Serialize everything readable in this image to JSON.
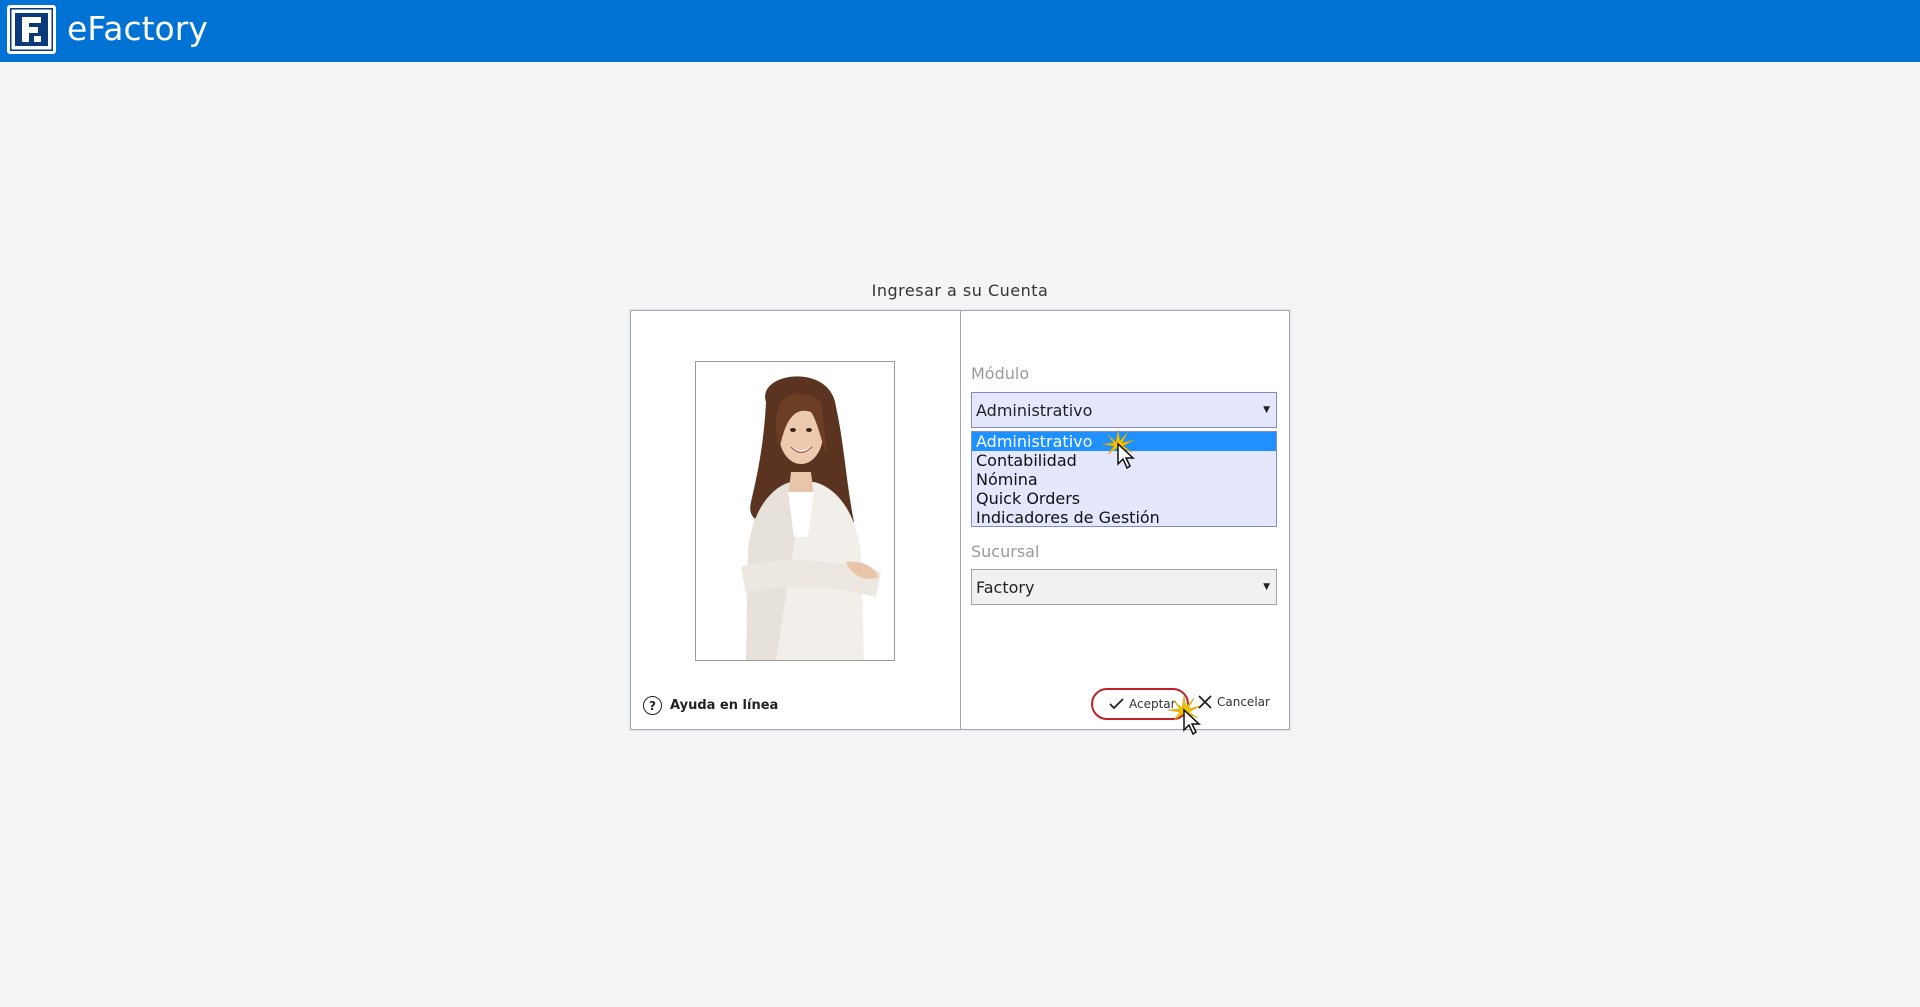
{
  "app": {
    "title": "eFactory",
    "logo_letter": "F"
  },
  "dialog": {
    "caption": "Ingresar a su Cuenta",
    "help_label": "Ayuda en línea",
    "modulo": {
      "label": "Módulo",
      "value": "Administrativo",
      "options": [
        "Administrativo",
        "Contabilidad",
        "Nómina",
        "Quick Orders",
        "Indicadores de Gestión"
      ]
    },
    "sucursal": {
      "label": "Sucursal",
      "value": "Factory"
    },
    "accept_label": "Aceptar",
    "cancel_label": "Cancelar"
  },
  "icons": {
    "logo": "efactory-logo-icon",
    "help": "question-circle-icon",
    "accept": "checkmark-icon",
    "cancel": "close-x-icon",
    "dropdown": "triangle-down-icon"
  },
  "colors": {
    "topbar": "#0072d3",
    "page_background": "#f4f5f7",
    "selected_option": "#1e90ff",
    "accept_highlight": "#c0202a"
  }
}
